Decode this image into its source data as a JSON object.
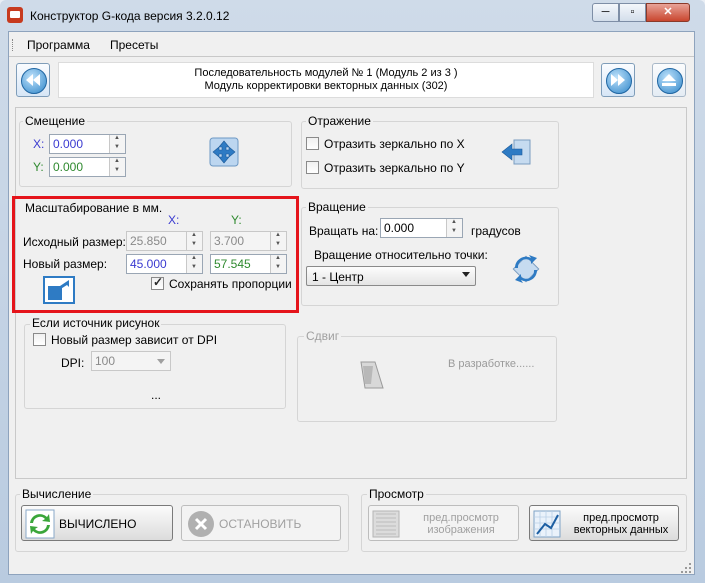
{
  "window": {
    "title": "Конструктор G-кода версия 3.2.0.12"
  },
  "menu": {
    "items": [
      "Программа",
      "Пресеты"
    ]
  },
  "banner": {
    "line1": "Последовательность модулей № 1 (Модуль 2 из 3 )",
    "line2": "Модуль корректировки векторных данных (302)"
  },
  "offset": {
    "title": "Смещение",
    "x_label": "X:",
    "x_value": "0.000",
    "y_label": "Y:",
    "y_value": "0.000"
  },
  "mirror": {
    "title": "Отражение",
    "mirror_x": "Отразить зеркально по X",
    "mirror_y": "Отразить зеркально по Y"
  },
  "scale": {
    "title": "Масштабирование в мм.",
    "col_x": "X:",
    "col_y": "Y:",
    "source_label": "Исходный размер:",
    "source_x": "25.850",
    "source_y": "3.700",
    "new_label": "Новый размер:",
    "new_x": "45.000",
    "new_y": "57.545",
    "keep_ratio": "Сохранять пропорции",
    "keep_ratio_checked": true
  },
  "rotation": {
    "title": "Вращение",
    "rotate_label": "Вращать на:",
    "rotate_value": "0.000",
    "unit": "градусов",
    "point_label": "Вращение относительно точки:",
    "point_value": "1 - Центр"
  },
  "image_source": {
    "title": "Если источник рисунок",
    "dpi_depends": "Новый размер зависит от DPI",
    "dpi_label": "DPI:",
    "dpi_value": "100",
    "more": "..."
  },
  "shift": {
    "title": "Сдвиг",
    "placeholder": "В разработке......"
  },
  "compute": {
    "title": "Вычисление",
    "computed_button": "ВЫЧИСЛЕНО",
    "stop_button": "ОСТАНОВИТЬ"
  },
  "preview": {
    "title": "Просмотр",
    "image_line1": "пред.просмотр",
    "image_line2": "изображения",
    "vector_line1": "пред.просмотр",
    "vector_line2": "векторных данных"
  },
  "colors": {
    "accent": "#3a3ad0",
    "green_value": "#2f8a2f",
    "highlight_frame": "#e5141b"
  }
}
